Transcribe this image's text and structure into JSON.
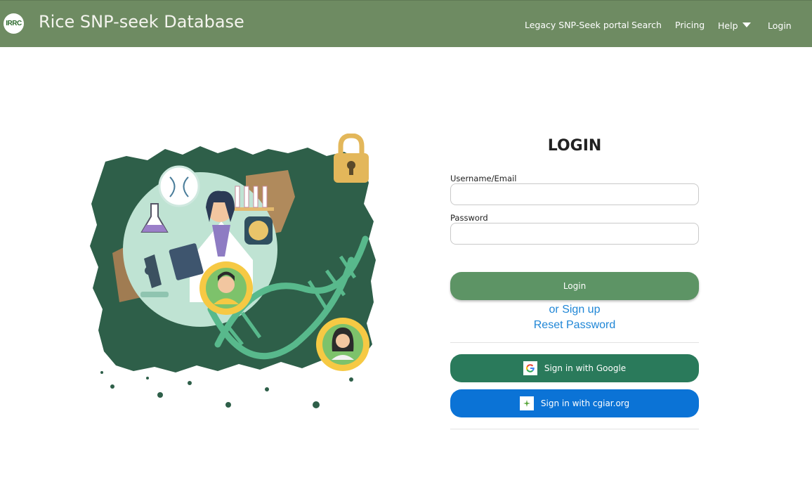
{
  "navbar": {
    "logo_text": "IRRC",
    "title": "Rice SNP-seek Database",
    "links": {
      "legacy": "Legacy SNP-Seek portal",
      "search": "Search",
      "pricing": "Pricing",
      "help": "Help",
      "login": "Login"
    },
    "help_icon": "caret-down-icon",
    "background_color": "#6e8b62"
  },
  "login": {
    "title": "LOGIN",
    "username_label": "Username/Email",
    "username_value": "",
    "password_label": "Password",
    "password_value": "",
    "submit_label": "Login",
    "signup_link": "or Sign up",
    "reset_link": "Reset Password",
    "google_label": "Sign in with Google",
    "google_icon": "google-icon",
    "cgiar_label": "Sign in with cgiar.org",
    "cgiar_icon": "cgiar-icon"
  },
  "colors": {
    "accent_green": "#5d9465",
    "google_button": "#2a7a5b",
    "cgiar_button": "#0b73d6",
    "link_blue": "#1f86d6"
  }
}
